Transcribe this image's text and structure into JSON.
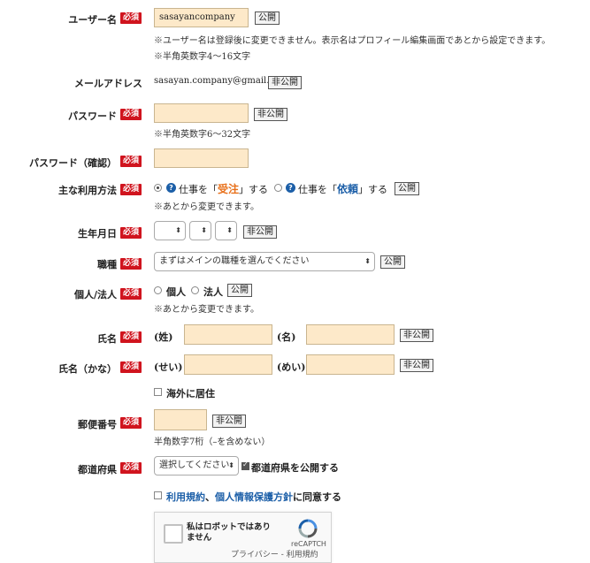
{
  "labels": {
    "username": "ユーザー名",
    "email": "メールアドレス",
    "password": "パスワード",
    "password_confirm": "パスワード（確認）",
    "usage": "主な利用方法",
    "birthday": "生年月日",
    "occupation": "職種",
    "entity": "個人/法人",
    "name": "氏名",
    "name_kana": "氏名（かな）",
    "postal": "郵便番号",
    "prefecture": "都道府県"
  },
  "required_badge": "必須",
  "badges": {
    "public": "公開",
    "private": "非公開"
  },
  "username": {
    "value": "sasayancompany",
    "note1": "※ユーザー名は登録後に変更できません。表示名はプロフィール編集画面であとから設定できます。",
    "note2": "※半角英数字4〜16文字"
  },
  "email": {
    "value": "sasayan.company@gmail.com"
  },
  "password": {
    "note": "※半角英数字6〜32文字"
  },
  "usage": {
    "option1_pre": "仕事を「",
    "option1_em": "受注",
    "option1_post": "」する",
    "option2_pre": "仕事を「",
    "option2_em": "依頼",
    "option2_post": "」する",
    "note": "※あとから変更できます。"
  },
  "occupation": {
    "selected": "まずはメインの職種を選んでください"
  },
  "entity": {
    "option1": "個人",
    "option2": "法人",
    "note": "※あとから変更できます。"
  },
  "name": {
    "last_label": "(姓)",
    "first_label": "(名)"
  },
  "name_kana": {
    "last_label": "(せい)",
    "first_label": "(めい)"
  },
  "overseas": {
    "label": "海外に居住"
  },
  "postal": {
    "note": "半角数字7桁（–を含めない）"
  },
  "prefecture": {
    "selected": "選択してください",
    "publish_label": "都道府県を公開する"
  },
  "agree": {
    "terms_link": "利用規約",
    "sep": "、",
    "privacy_link": "個人情報保護方針",
    "suffix": "に同意する"
  },
  "recaptcha": {
    "label": "私はロボットではありません",
    "brand": "reCAPTCH",
    "privacy": "プライバシー",
    "dash": " - ",
    "terms": "利用規約"
  },
  "colors": {
    "required": "#d0141e",
    "input_bg": "#fde9c9",
    "link": "#1c5fa8",
    "accent_orange": "#e8701a"
  },
  "icons": {
    "help": "question-circle-icon",
    "select_arrow": "updown-arrows-icon",
    "recaptcha": "recaptcha-logo-icon"
  }
}
